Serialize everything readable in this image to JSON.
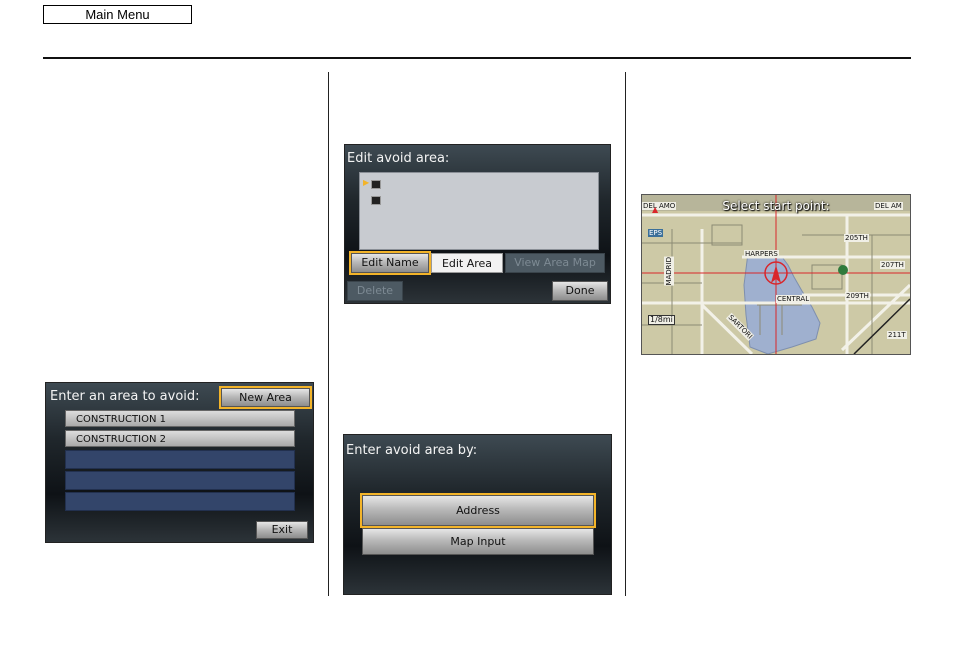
{
  "main_menu": {
    "label": "Main Menu"
  },
  "screen_avoid_list": {
    "title": "Enter an area to avoid:",
    "new_area_button": "New Area",
    "items": [
      "CONSTRUCTION 1",
      "CONSTRUCTION 2",
      "",
      "",
      ""
    ],
    "exit_button": "Exit"
  },
  "screen_edit_area": {
    "title": "Edit avoid area:",
    "edit_name_button": "Edit Name",
    "edit_area_button": "Edit Area",
    "view_map_button": "View Area Map",
    "delete_button": "Delete",
    "done_button": "Done"
  },
  "screen_enter_by": {
    "title": "Enter avoid area by:",
    "address_button": "Address",
    "map_input_button": "Map Input"
  },
  "screen_map": {
    "banner": "Select start point:",
    "labels": {
      "del_amo_left": "DEL AMO",
      "del_amo_right": "DEL AM",
      "street_205": "205TH",
      "street_207": "207TH",
      "street_209": "209TH",
      "street_211": "211T",
      "harpers": "HARPERS",
      "central": "CENTRAL",
      "madrid": "MADRID",
      "sartori": "SARTORI",
      "scale": "1/8mi",
      "poi_tag": "EPS"
    }
  },
  "colors": {
    "highlight": "#f3b429",
    "map_land": "#cdc9a6",
    "map_water": "#9fb0cf",
    "cursor": "#d9262a"
  }
}
